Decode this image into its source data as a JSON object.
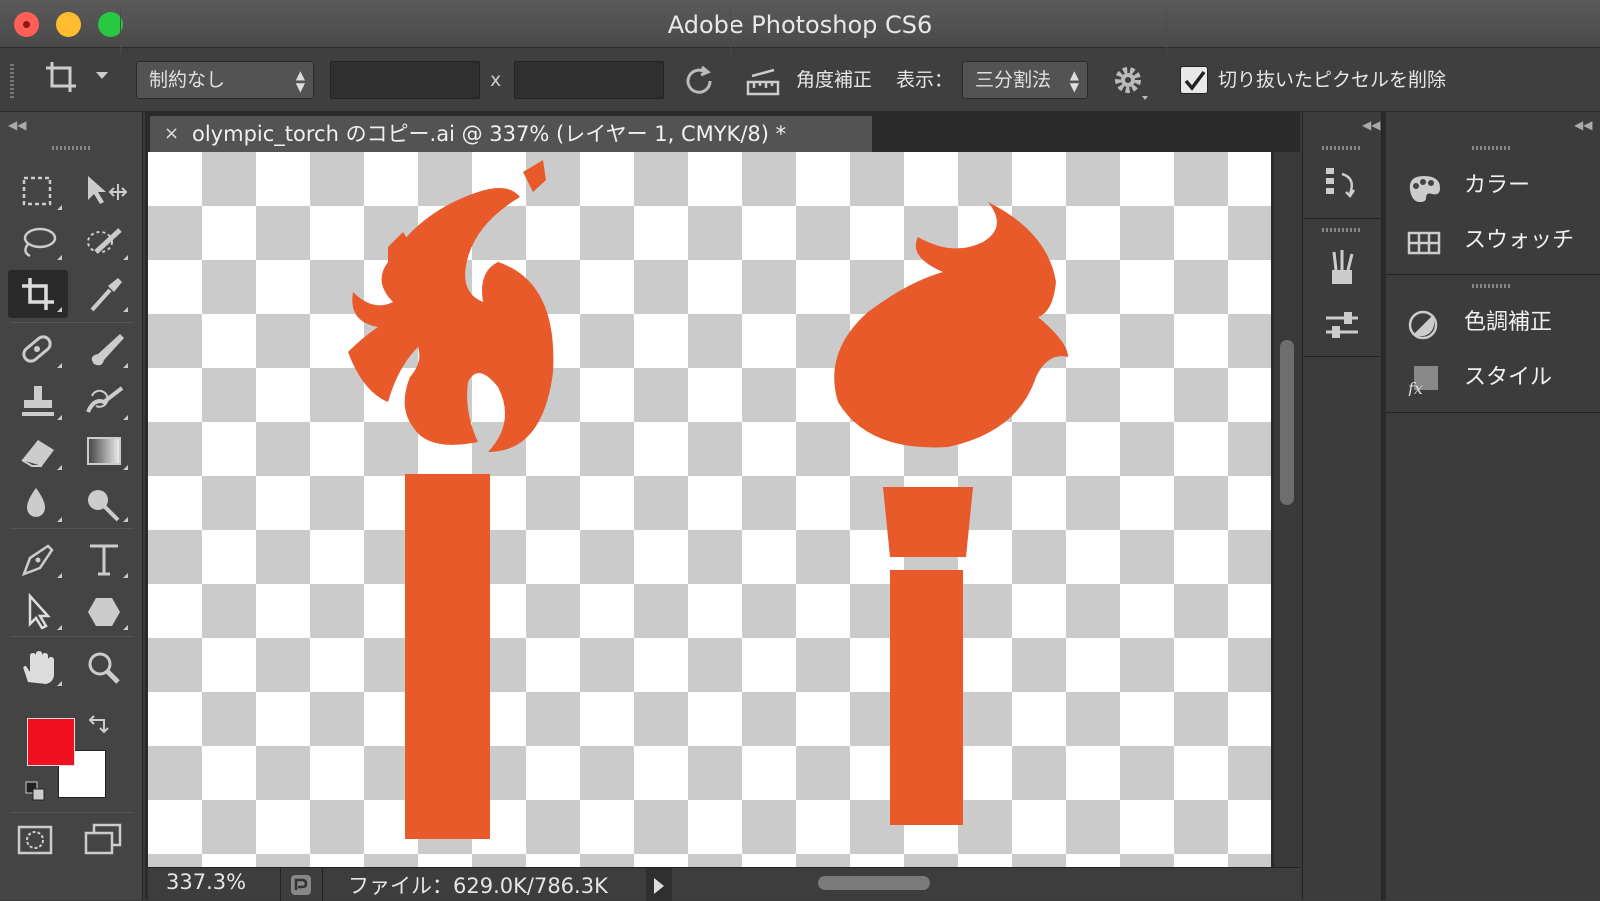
{
  "app": {
    "title": "Adobe Photoshop CS6"
  },
  "window_controls": {
    "close_color": "#ff5f57",
    "minimize_color": "#febc2e",
    "zoom_color": "#28c840"
  },
  "options": {
    "constraint": "制約なし",
    "width_value": "",
    "height_value": "",
    "times_symbol": "x",
    "straighten_label": "角度補正",
    "view_label": "表示：",
    "overlay": "三分割法",
    "delete_pixels_checked": true,
    "delete_pixels_label": "切り抜いたピクセルを削除"
  },
  "document": {
    "tab_close": "×",
    "tab_title": "olympic_torch のコピー.ai @ 337% (レイヤー 1, CMYK/8) *",
    "zoom": "337.3%",
    "file_info": "ファイル：629.0K/786.3K"
  },
  "colors": {
    "foreground": "#f01020",
    "background": "#ffffff",
    "artwork": "#e85a2a"
  },
  "panels": [
    {
      "label": "カラー",
      "icon": "color-palette-icon"
    },
    {
      "label": "スウォッチ",
      "icon": "swatches-grid-icon"
    },
    {
      "label": "色調補正",
      "icon": "adjustments-icon"
    },
    {
      "label": "スタイル",
      "icon": "styles-fx-icon"
    }
  ]
}
